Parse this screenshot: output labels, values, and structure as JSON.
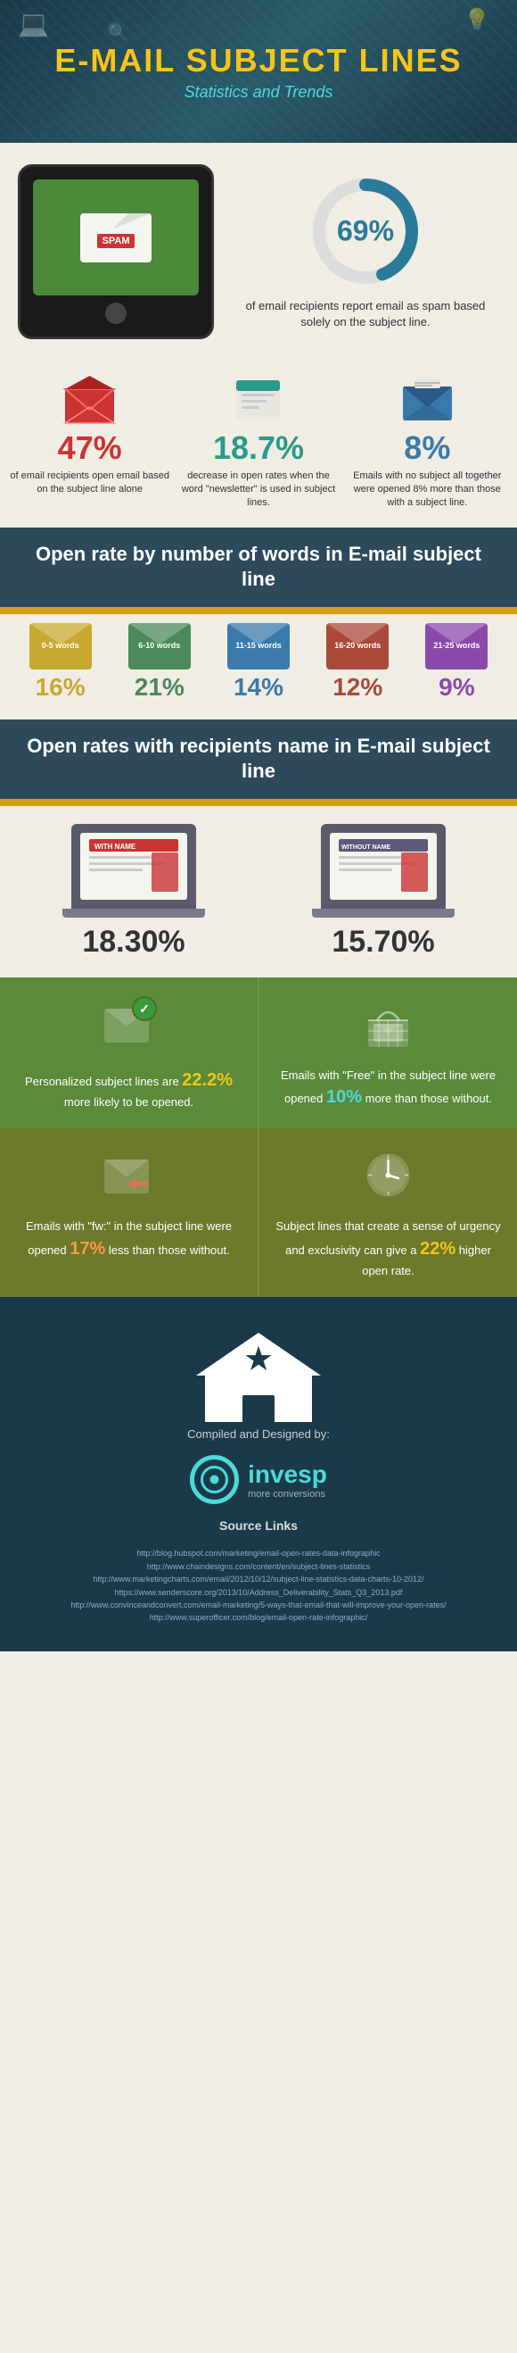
{
  "header": {
    "title": "E-MAIL SUBJECT LINES",
    "subtitle": "Statistics and Trends"
  },
  "spam_block": {
    "spam_label": "SPAM",
    "donut_pct": "69%",
    "donut_desc": "of email recipients report email as spam based solely on the subject line."
  },
  "three_stats": [
    {
      "pct": "47%",
      "desc": "of email recipients open email based on the subject line alone",
      "color": "red"
    },
    {
      "pct": "18.7%",
      "desc": "decrease in open rates when the word \"newsletter\" is used in subject lines.",
      "color": "teal"
    },
    {
      "pct": "8%",
      "desc": "Emails with no subject all together were opened 8% more than those with a subject line.",
      "color": "blue"
    }
  ],
  "open_rate_words": {
    "section_title": "Open rate by number of words in E-mail subject line",
    "items": [
      {
        "range": "0-5 words",
        "pct": "16%",
        "color": "color1"
      },
      {
        "range": "6-10 words",
        "pct": "21%",
        "color": "color2"
      },
      {
        "range": "11-15 words",
        "pct": "14%",
        "color": "color3"
      },
      {
        "range": "16-20 words",
        "pct": "12%",
        "color": "color4"
      },
      {
        "range": "21-25 words",
        "pct": "9%",
        "color": "color5"
      }
    ]
  },
  "open_rate_names": {
    "section_title": "Open rates with recipients name in E-mail subject line",
    "with_name": {
      "label": "WITH NAME",
      "pct": "18.30%"
    },
    "without_name": {
      "label": "WITHOUT NAME",
      "pct": "15.70%"
    }
  },
  "green_stats": [
    {
      "highlight": "22.2%",
      "highlight_color": "yellow",
      "text_before": "Personalized subject lines are ",
      "text_after": " more likely to be opened."
    },
    {
      "highlight": "10%",
      "highlight_color": "teal",
      "text_before": "Emails with \"Free\" in the subject line were opened ",
      "text_after": " more than those without."
    }
  ],
  "olive_stats": [
    {
      "highlight": "17%",
      "highlight_color": "orange",
      "text_before": "Emails with \"fw:\" in the subject line were opened ",
      "text_after": " less than those without."
    },
    {
      "highlight": "22%",
      "highlight_color": "yellow",
      "text_before": "Subject lines that create a sense of urgency and exclusivity can give a ",
      "text_after": " higher open rate."
    }
  ],
  "footer": {
    "compiled_label": "Compiled and Designed by:",
    "logo_name": "invesp",
    "logo_tagline": "more conversions",
    "source_title": "Source Links",
    "sources": [
      "http://blog.hubspot.com/marketing/email-open-rates-data-infographic",
      "http://www.chaindesigns.com/content/en/subject-lines-statistics",
      "http://www.marketingcharts.com/email/2012/10/12/subject-line-statistics-data-charts-10-2012/",
      "https://www.senderscore.org/2013/10/Address_Deliverability_Stats_Q3_2013.pdf",
      "http://www.convinceandconvert.com/email-marketing/5-ways-that-email-that-will-improve-your-open-rates/",
      "http://www.superofficer.com/blog/email-open-rate-infographic/"
    ]
  }
}
